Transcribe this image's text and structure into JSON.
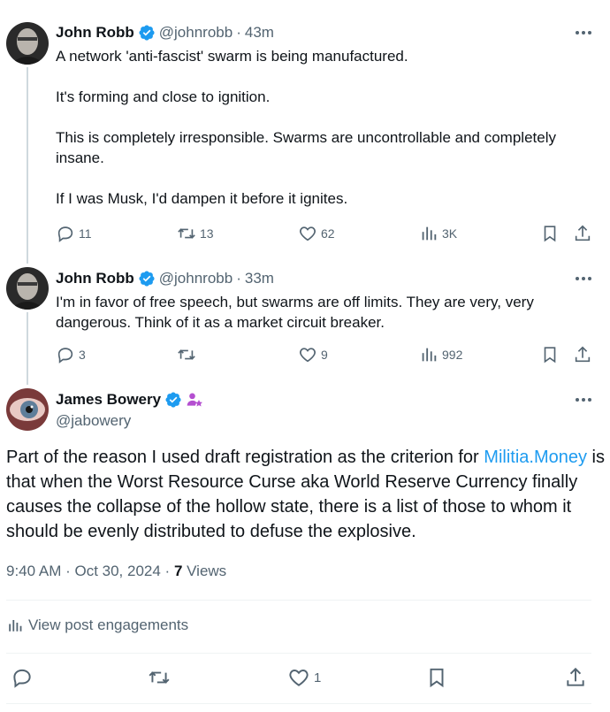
{
  "tweets": [
    {
      "author": "John Robb",
      "handle": "@johnrobb",
      "separator": "·",
      "time": "43m",
      "text": "A network 'anti-fascist' swarm is being manufactured.\n\nIt's forming and close to ignition.\n\nThis is completely irresponsible.  Swarms are uncontrollable and completely insane.\n\nIf I was Musk, I'd dampen it before it ignites.",
      "replies": "11",
      "reposts": "13",
      "likes": "62",
      "views": "3K"
    },
    {
      "author": "John Robb",
      "handle": "@johnrobb",
      "separator": "·",
      "time": "33m",
      "text": "I'm in favor of free speech, but swarms are off limits.  They are very, very dangerous.  Think of it as a market circuit breaker.",
      "replies": "3",
      "reposts": "",
      "likes": "9",
      "views": "992"
    }
  ],
  "main_post": {
    "author": "James Bowery",
    "handle": "@jabowery",
    "text_before": "Part of the reason I used draft registration as the criterion for ",
    "link_text": "Militia.Money",
    "text_after": " is that when the Worst Resource Curse aka World Reserve Currency finally causes the collapse of the hollow state, there is a list of those to whom it should be evenly distributed to defuse the explosive.",
    "timestamp": "9:40 AM · Oct 30, 2024 · ",
    "views_count": "7",
    "views_label": " Views",
    "engagements_label": "View post engagements",
    "likes": "1"
  },
  "colors": {
    "accent": "#1d9bf0",
    "secondary_text": "#536471",
    "purple_badge": "#b44fd0"
  }
}
